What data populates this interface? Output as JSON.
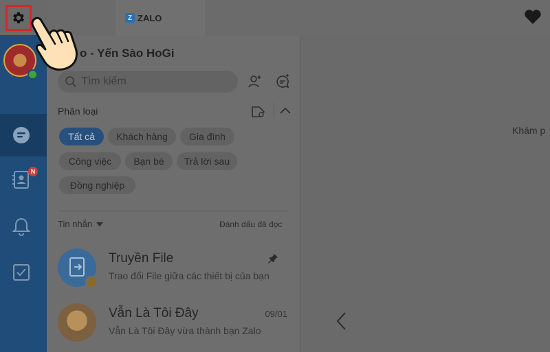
{
  "app": {
    "tab_label": "ZALO",
    "logo_letter": "Z",
    "account_title": "o - Yến Sào HoGi"
  },
  "nav": {
    "badge": "N",
    "icons": [
      "settings-icon",
      "chat-icon",
      "contacts-icon",
      "bell-icon",
      "todo-icon"
    ]
  },
  "search": {
    "placeholder": "Tìm kiếm"
  },
  "filters": {
    "section_label": "Phân loại",
    "chips": [
      "Tất cả",
      "Khách hàng",
      "Gia đình",
      "Công việc",
      "Bạn bè",
      "Trả lời sau",
      "Đồng nghiệp"
    ],
    "active_index": 0
  },
  "messages": {
    "header": "Tin nhắn",
    "mark_all_read": "Đánh dấu đã đọc"
  },
  "conversations": [
    {
      "name": "Truyền File",
      "preview": "Trao đổi File giữa các thiết bị của bạn",
      "time": "",
      "pinned": true
    },
    {
      "name": "Vẫn Là Tôi Đây",
      "preview": "Vẫn Là Tôi Đây vừa thành bạn Zalo",
      "time": "09/01",
      "pinned": false
    }
  ],
  "right_panel": {
    "text": "Khám p"
  },
  "colors": {
    "nav_bg": "#1f4c78",
    "highlight_border": "#d8262a",
    "active_chip": "#27507e"
  }
}
